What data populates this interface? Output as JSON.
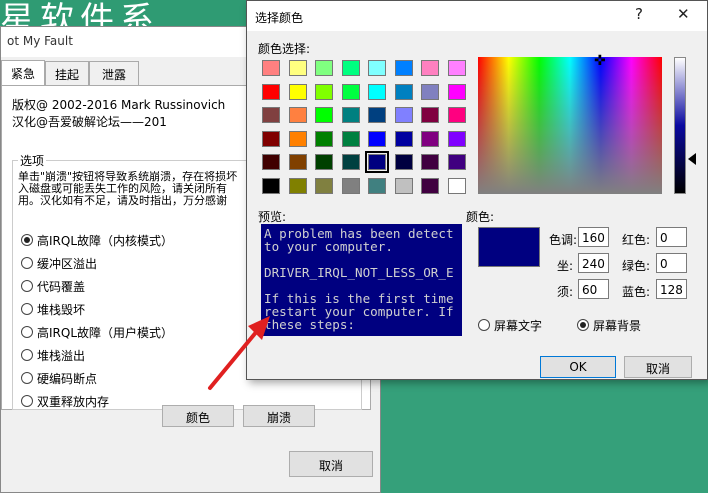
{
  "background": {
    "banner_text": "星软件系…"
  },
  "main_window": {
    "title": "ot My Fault",
    "tabs": [
      "紧急",
      "挂起",
      "泄露"
    ],
    "copyright": "版权@ 2002-2016 Mark Russinovich",
    "localized_by": "汉化@吾爱破解论坛——201",
    "options_label": "选项",
    "description": [
      "单击\"崩溃\"按钮将导致系统崩溃，存在将损坏",
      "入磁盘或可能丢失工作的风险，请关闭所有",
      "用。汉化如有不足，请及时指出，万分感谢"
    ],
    "options": [
      "高IRQL故障（内核模式）",
      "缓冲区溢出",
      "代码覆盖",
      "堆栈毁坏",
      "高IRQL故障（用户模式）",
      "堆栈溢出",
      "硬编码断点",
      "双重释放内存"
    ],
    "selected_option_index": 0,
    "color_button": "颜色",
    "crash_button": "崩溃",
    "cancel_button": "取消"
  },
  "color_dialog": {
    "title": "选择颜色",
    "help_button": "?",
    "close_button": "✕",
    "basic_colors_label": "颜色选择:",
    "swatch_colors": [
      [
        "#ff8080",
        "#ffff80",
        "#80ff80",
        "#00ff80",
        "#80ffff",
        "#0080ff",
        "#ff80c0",
        "#ff80ff"
      ],
      [
        "#ff0000",
        "#ffff00",
        "#80ff00",
        "#00ff40",
        "#00ffff",
        "#0080c0",
        "#8080c0",
        "#ff00ff"
      ],
      [
        "#804040",
        "#ff8040",
        "#00ff00",
        "#008080",
        "#004080",
        "#8080ff",
        "#800040",
        "#ff0080"
      ],
      [
        "#800000",
        "#ff8000",
        "#008000",
        "#008040",
        "#0000ff",
        "#0000a0",
        "#800080",
        "#8000ff"
      ],
      [
        "#400000",
        "#804000",
        "#004000",
        "#004040",
        "#000080",
        "#000040",
        "#400040",
        "#400080"
      ],
      [
        "#000000",
        "#808000",
        "#808040",
        "#808080",
        "#408080",
        "#c0c0c0",
        "#400040",
        "#ffffff"
      ]
    ],
    "selected_swatch": {
      "row": 4,
      "col": 4
    },
    "preview_label": "预览:",
    "preview_text": "A problem has been detect\nto your computer.\n\nDRIVER_IRQL_NOT_LESS_OR_E\n\nIf this is the first time\nrestart your computer. If\nthese steps:",
    "color_label": "颜色:",
    "current_color": "#000080",
    "hue_label": "色调:",
    "hue": "160",
    "sat_label": "坐:",
    "sat": "240",
    "lum_label": "须:",
    "lum": "60",
    "red_label": "红色:",
    "red": "0",
    "green_label": "绿色:",
    "green": "0",
    "blue_label": "蓝色:",
    "blue": "128",
    "screen_text_label": "屏幕文字",
    "screen_bg_label": "屏幕背景",
    "selected_target": "screen_bg",
    "ok_button": "OK",
    "cancel_button": "取消"
  },
  "annotation": {
    "arrow_color": "#e02020"
  }
}
